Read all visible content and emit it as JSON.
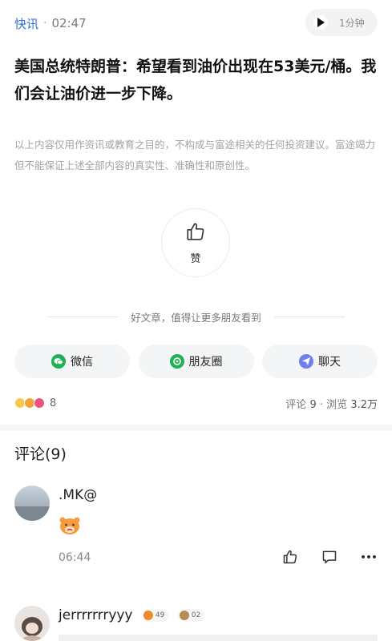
{
  "header": {
    "tag": "快讯",
    "separator": "·",
    "time": "02:47",
    "audio": {
      "duration": "1分钟",
      "icon": "play-icon"
    }
  },
  "article": {
    "headline": "美国总统特朗普：希望看到油价出现在53美元/桶。我们会让油价进一步下降。",
    "disclaimer": "以上内容仅用作资讯或教育之目的，不构成与富途相关的任何投资建议。富途竭力但不能保证上述全部内容的真实性、准确性和原创性。"
  },
  "like": {
    "label": "赞",
    "icon": "thumbs-up-icon"
  },
  "share": {
    "hint": "好文章，值得让更多朋友看到",
    "buttons": [
      {
        "label": "微信",
        "icon": "wechat-icon",
        "color": "#1fb155"
      },
      {
        "label": "朋友圈",
        "icon": "moments-icon",
        "color": "#1fb155"
      },
      {
        "label": "聊天",
        "icon": "chat-send-icon",
        "color": "#6f7ef0"
      }
    ]
  },
  "stats": {
    "reaction_count": "8",
    "comments_label": "评论",
    "comments_value": "9",
    "dot": "·",
    "views_label": "浏览",
    "views_value": "3.2万"
  },
  "comments": {
    "title": "评论(9)",
    "items": [
      {
        "name": ".MK@",
        "time": "06:44",
        "emoji": "tiger-emoji"
      },
      {
        "name": "jerrrrrrryyy",
        "badge1": "49",
        "badge2": "02"
      }
    ]
  },
  "colors": {
    "accent": "#2f6fd6",
    "wechat": "#1fb155",
    "chat": "#6f7ef0"
  }
}
